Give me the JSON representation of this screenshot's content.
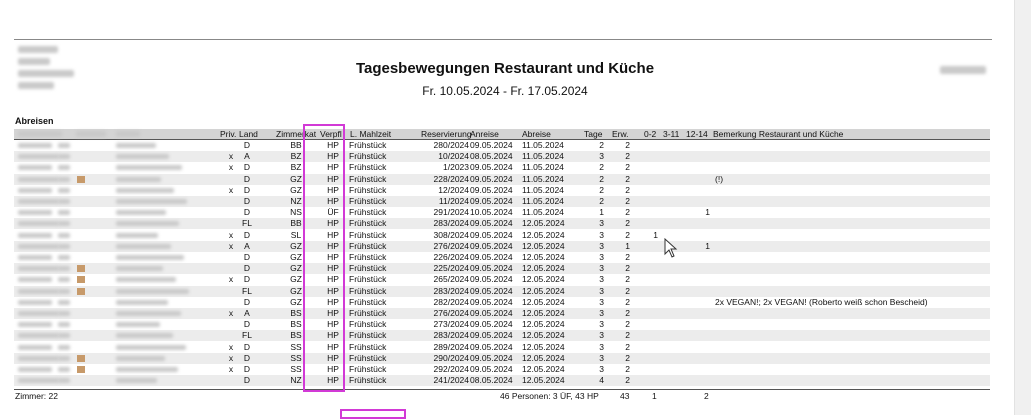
{
  "report": {
    "title": "Tagesbewegungen Restaurant und Küche",
    "date_range": "Fr. 10.05.2024 - Fr. 17.05.2024",
    "section": "Abreisen"
  },
  "columns": {
    "priv": "Priv.",
    "land": "Land",
    "zimmerkat": "Zimmerkat",
    "verpfl": "Verpfl",
    "lmahlzeit": "L. Mahlzeit",
    "reservierung": "Reservierung",
    "anreise": "Anreise",
    "abreise": "Abreise",
    "tage": "Tage",
    "erw": "Erw.",
    "k02": "0-2",
    "k311": "3-11",
    "k1214": "12-14",
    "bemerkung": "Bemerkung Restaurant und Küche"
  },
  "rows": [
    {
      "priv": "",
      "land": "D",
      "kat": "BB",
      "verpfl": "HP",
      "mahlzeit": "Frühstück",
      "res": "280/2024",
      "anreise": "09.05.2024",
      "abreise": "11.05.2024",
      "tage": "2",
      "erw": "2",
      "k02": "",
      "k311": "",
      "k1214": "",
      "bem": ""
    },
    {
      "priv": "x",
      "land": "A",
      "kat": "BZ",
      "verpfl": "HP",
      "mahlzeit": "Frühstück",
      "res": "10/2024",
      "anreise": "08.05.2024",
      "abreise": "11.05.2024",
      "tage": "3",
      "erw": "2",
      "k02": "",
      "k311": "",
      "k1214": "",
      "bem": ""
    },
    {
      "priv": "x",
      "land": "D",
      "kat": "BZ",
      "verpfl": "HP",
      "mahlzeit": "Frühstück",
      "res": "1/2023",
      "anreise": "09.05.2024",
      "abreise": "11.05.2024",
      "tage": "2",
      "erw": "2",
      "k02": "",
      "k311": "",
      "k1214": "",
      "bem": ""
    },
    {
      "priv": "",
      "land": "D",
      "kat": "GZ",
      "verpfl": "HP",
      "mahlzeit": "Frühstück",
      "res": "228/2024",
      "anreise": "09.05.2024",
      "abreise": "11.05.2024",
      "tage": "2",
      "erw": "2",
      "k02": "",
      "k311": "",
      "k1214": "",
      "bem": "(!)"
    },
    {
      "priv": "x",
      "land": "D",
      "kat": "GZ",
      "verpfl": "HP",
      "mahlzeit": "Frühstück",
      "res": "12/2024",
      "anreise": "09.05.2024",
      "abreise": "11.05.2024",
      "tage": "2",
      "erw": "2",
      "k02": "",
      "k311": "",
      "k1214": "",
      "bem": ""
    },
    {
      "priv": "",
      "land": "D",
      "kat": "NZ",
      "verpfl": "HP",
      "mahlzeit": "Frühstück",
      "res": "11/2024",
      "anreise": "09.05.2024",
      "abreise": "11.05.2024",
      "tage": "2",
      "erw": "2",
      "k02": "",
      "k311": "",
      "k1214": "",
      "bem": ""
    },
    {
      "priv": "",
      "land": "D",
      "kat": "NS",
      "verpfl": "ÜF",
      "mahlzeit": "Frühstück",
      "res": "291/2024",
      "anreise": "10.05.2024",
      "abreise": "11.05.2024",
      "tage": "1",
      "erw": "2",
      "k02": "",
      "k311": "",
      "k1214": "1",
      "bem": ""
    },
    {
      "priv": "",
      "land": "FL",
      "kat": "BB",
      "verpfl": "HP",
      "mahlzeit": "Frühstück",
      "res": "283/2024",
      "anreise": "09.05.2024",
      "abreise": "12.05.2024",
      "tage": "3",
      "erw": "2",
      "k02": "",
      "k311": "",
      "k1214": "",
      "bem": ""
    },
    {
      "priv": "x",
      "land": "D",
      "kat": "SL",
      "verpfl": "HP",
      "mahlzeit": "Frühstück",
      "res": "308/2024",
      "anreise": "09.05.2024",
      "abreise": "12.05.2024",
      "tage": "3",
      "erw": "2",
      "k02": "1",
      "k311": "",
      "k1214": "",
      "bem": ""
    },
    {
      "priv": "x",
      "land": "A",
      "kat": "GZ",
      "verpfl": "HP",
      "mahlzeit": "Frühstück",
      "res": "276/2024",
      "anreise": "09.05.2024",
      "abreise": "12.05.2024",
      "tage": "3",
      "erw": "1",
      "k02": "",
      "k311": "",
      "k1214": "1",
      "bem": ""
    },
    {
      "priv": "",
      "land": "D",
      "kat": "GZ",
      "verpfl": "HP",
      "mahlzeit": "Frühstück",
      "res": "226/2024",
      "anreise": "09.05.2024",
      "abreise": "12.05.2024",
      "tage": "3",
      "erw": "2",
      "k02": "",
      "k311": "",
      "k1214": "",
      "bem": ""
    },
    {
      "priv": "",
      "land": "D",
      "kat": "GZ",
      "verpfl": "HP",
      "mahlzeit": "Frühstück",
      "res": "225/2024",
      "anreise": "09.05.2024",
      "abreise": "12.05.2024",
      "tage": "3",
      "erw": "2",
      "k02": "",
      "k311": "",
      "k1214": "",
      "bem": ""
    },
    {
      "priv": "x",
      "land": "D",
      "kat": "GZ",
      "verpfl": "HP",
      "mahlzeit": "Frühstück",
      "res": "265/2024",
      "anreise": "09.05.2024",
      "abreise": "12.05.2024",
      "tage": "3",
      "erw": "2",
      "k02": "",
      "k311": "",
      "k1214": "",
      "bem": ""
    },
    {
      "priv": "",
      "land": "FL",
      "kat": "GZ",
      "verpfl": "HP",
      "mahlzeit": "Frühstück",
      "res": "283/2024",
      "anreise": "09.05.2024",
      "abreise": "12.05.2024",
      "tage": "3",
      "erw": "2",
      "k02": "",
      "k311": "",
      "k1214": "",
      "bem": ""
    },
    {
      "priv": "",
      "land": "D",
      "kat": "GZ",
      "verpfl": "HP",
      "mahlzeit": "Frühstück",
      "res": "282/2024",
      "anreise": "09.05.2024",
      "abreise": "12.05.2024",
      "tage": "3",
      "erw": "2",
      "k02": "",
      "k311": "",
      "k1214": "",
      "bem": "2x VEGAN!; 2x VEGAN! (Roberto weiß schon Bescheid)"
    },
    {
      "priv": "x",
      "land": "A",
      "kat": "BS",
      "verpfl": "HP",
      "mahlzeit": "Frühstück",
      "res": "276/2024",
      "anreise": "09.05.2024",
      "abreise": "12.05.2024",
      "tage": "3",
      "erw": "2",
      "k02": "",
      "k311": "",
      "k1214": "",
      "bem": ""
    },
    {
      "priv": "",
      "land": "D",
      "kat": "BS",
      "verpfl": "HP",
      "mahlzeit": "Frühstück",
      "res": "273/2024",
      "anreise": "09.05.2024",
      "abreise": "12.05.2024",
      "tage": "3",
      "erw": "2",
      "k02": "",
      "k311": "",
      "k1214": "",
      "bem": ""
    },
    {
      "priv": "",
      "land": "FL",
      "kat": "BS",
      "verpfl": "HP",
      "mahlzeit": "Frühstück",
      "res": "283/2024",
      "anreise": "09.05.2024",
      "abreise": "12.05.2024",
      "tage": "3",
      "erw": "2",
      "k02": "",
      "k311": "",
      "k1214": "",
      "bem": ""
    },
    {
      "priv": "x",
      "land": "D",
      "kat": "SS",
      "verpfl": "HP",
      "mahlzeit": "Frühstück",
      "res": "289/2024",
      "anreise": "09.05.2024",
      "abreise": "12.05.2024",
      "tage": "3",
      "erw": "2",
      "k02": "",
      "k311": "",
      "k1214": "",
      "bem": ""
    },
    {
      "priv": "x",
      "land": "D",
      "kat": "SS",
      "verpfl": "HP",
      "mahlzeit": "Frühstück",
      "res": "290/2024",
      "anreise": "09.05.2024",
      "abreise": "12.05.2024",
      "tage": "3",
      "erw": "2",
      "k02": "",
      "k311": "",
      "k1214": "",
      "bem": ""
    },
    {
      "priv": "x",
      "land": "D",
      "kat": "SS",
      "verpfl": "HP",
      "mahlzeit": "Frühstück",
      "res": "292/2024",
      "anreise": "09.05.2024",
      "abreise": "12.05.2024",
      "tage": "3",
      "erw": "2",
      "k02": "",
      "k311": "",
      "k1214": "",
      "bem": ""
    },
    {
      "priv": "",
      "land": "D",
      "kat": "NZ",
      "verpfl": "HP",
      "mahlzeit": "Frühstück",
      "res": "241/2024",
      "anreise": "08.05.2024",
      "abreise": "12.05.2024",
      "tage": "4",
      "erw": "2",
      "k02": "",
      "k311": "",
      "k1214": "",
      "bem": ""
    }
  ],
  "totals": {
    "zimmer": "Zimmer: 22",
    "personen": "46 Personen: 3 ÜF, 43 HP",
    "erw": "43",
    "k02": "1",
    "k1214": "2"
  },
  "colors": {
    "highlight": "#d23ad6",
    "header_bg": "#d4d4d4",
    "alt_row": "#ececec"
  }
}
